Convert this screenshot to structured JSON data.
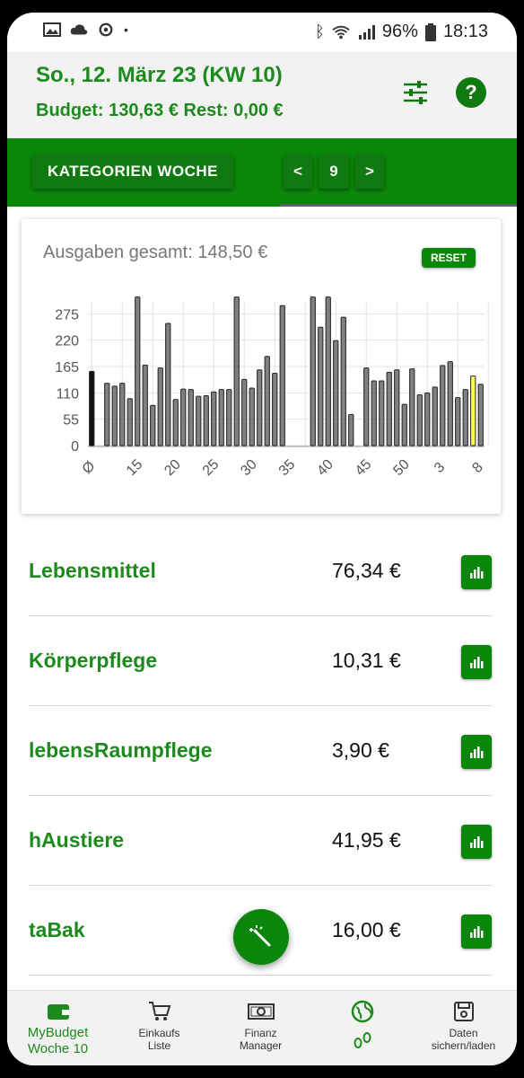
{
  "status_bar": {
    "battery": "96%",
    "time": "18:13"
  },
  "header": {
    "date_title": "So., 12. März 23 (KW 10)",
    "budget_text": "Budget: 130,63 € Rest: 0,00 €",
    "filter_icon": "sliders-icon",
    "help_label": "?"
  },
  "toolbar": {
    "category_week_label": "KATEGORIEN WOCHE",
    "prev_label": "<",
    "week_number": "9",
    "next_label": ">"
  },
  "chart_card": {
    "title": "Ausgaben gesamt: 148,50 €",
    "reset_label": "RESET"
  },
  "chart_data": {
    "type": "bar",
    "title": "Ausgaben gesamt: 148,50 €",
    "ylim": [
      0,
      300
    ],
    "yticks": [
      "0",
      "55",
      "110",
      "165",
      "220",
      "275"
    ],
    "xtick_labels": [
      "Ø",
      "15",
      "20",
      "25",
      "30",
      "35",
      "40",
      "45",
      "50",
      "3",
      "8"
    ],
    "grid": true,
    "colors": {
      "average": "#111111",
      "normal": "#808080",
      "current": "#ffff55"
    },
    "values": [
      155,
      null,
      130,
      124,
      130,
      98,
      310,
      168,
      84,
      162,
      255,
      96,
      118,
      117,
      103,
      104,
      112,
      117,
      117,
      310,
      138,
      120,
      158,
      186,
      151,
      292,
      null,
      null,
      null,
      310,
      247,
      310,
      219,
      268,
      65,
      null,
      162,
      135,
      135,
      153,
      158,
      86,
      160,
      106,
      110,
      122,
      167,
      175,
      100,
      117,
      145,
      128
    ],
    "highlighted_index": 50,
    "average_index": 0
  },
  "categories": [
    {
      "name": "Lebensmittel",
      "amount": "76,34 €"
    },
    {
      "name": "Körperpflege",
      "amount": "10,31 €"
    },
    {
      "name": "lebensRaumpflege",
      "amount": "3,90 €"
    },
    {
      "name": "hAustiere",
      "amount": "41,95 €"
    },
    {
      "name": "taBak",
      "amount": "16,00 €"
    }
  ],
  "fab": {
    "icon": "magic-wand-icon"
  },
  "bottom_nav": [
    {
      "label_line1": "MyBudget",
      "label_line2": "Woche 10",
      "icon": "wallet-icon",
      "active": true
    },
    {
      "label_line1": "Einkaufs",
      "label_line2": "Liste",
      "icon": "cart-icon",
      "active": false
    },
    {
      "label_line1": "Finanz",
      "label_line2": "Manager",
      "icon": "money-icon",
      "active": false
    },
    {
      "label_line1": "",
      "label_line2": "",
      "icon": "globe-icon",
      "active": false
    },
    {
      "label_line1": "Daten",
      "label_line2": "sichern/laden",
      "icon": "save-icon",
      "active": false
    }
  ]
}
